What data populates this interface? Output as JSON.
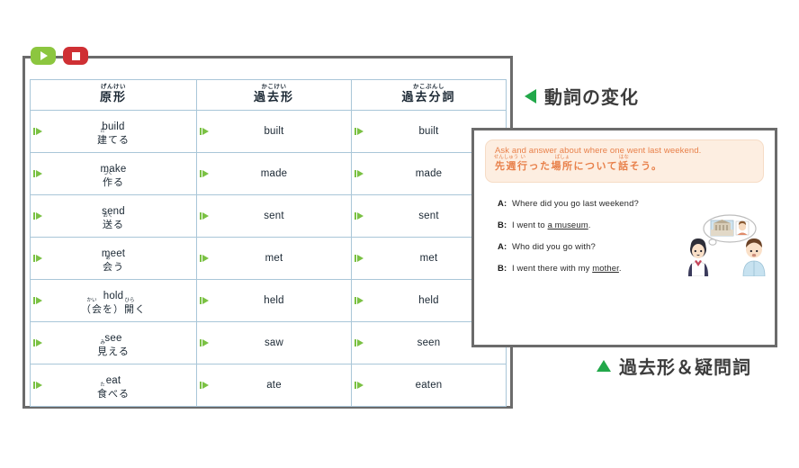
{
  "window": {
    "transport": [
      {
        "name": "play-button",
        "icon": "play-icon",
        "color": "#8cc63f"
      },
      {
        "name": "stop-button",
        "icon": "stop-icon",
        "color": "#cf3034"
      }
    ]
  },
  "table": {
    "headers": [
      {
        "furigana": "げんけい",
        "label": "原形"
      },
      {
        "furigana": "かこけい",
        "label": "過去形"
      },
      {
        "furigana": "かこぶんし",
        "label": "過去分詞"
      }
    ],
    "rows": [
      {
        "base_en": "build",
        "base_jp_ruby": "た",
        "base_jp_kanji": "建",
        "base_jp_tail": "てる",
        "past": "built",
        "participle": "built"
      },
      {
        "base_en": "make",
        "base_jp_ruby": "つく",
        "base_jp_kanji": "作",
        "base_jp_tail": "る",
        "past": "made",
        "participle": "made"
      },
      {
        "base_en": "send",
        "base_jp_ruby": "おく",
        "base_jp_kanji": "送",
        "base_jp_tail": "る",
        "past": "sent",
        "participle": "sent"
      },
      {
        "base_en": "meet",
        "base_jp_ruby": "あ",
        "base_jp_kanji": "会",
        "base_jp_tail": "う",
        "past": "met",
        "participle": "met"
      },
      {
        "base_en": "hold",
        "base_jp_ruby": "かい",
        "base_jp_kanji": "（会",
        "base_jp_tail": "を）",
        "base_jp_ruby2": "ひら",
        "base_jp_kanji2": "開",
        "base_jp_tail2": "く",
        "past": "held",
        "participle": "held"
      },
      {
        "base_en": "see",
        "base_jp_ruby": "み",
        "base_jp_kanji": "見",
        "base_jp_tail": "える",
        "past": "saw",
        "participle": "seen"
      },
      {
        "base_en": "eat",
        "base_jp_ruby": "た",
        "base_jp_kanji": "食",
        "base_jp_tail": "べる",
        "past": "ate",
        "participle": "eaten"
      }
    ]
  },
  "labels": {
    "verbs": "動詞の変化",
    "past": "過去形＆疑問詞"
  },
  "popup": {
    "task_en": "Ask and answer about where one went last weekend.",
    "task_jp": {
      "r1": "せんしゅう",
      "k1": "先週",
      "r2": "い",
      "k2": "行",
      "t2": "った",
      "r3": "ばしょ",
      "k3": "場所",
      "t3": "について",
      "r4": "はな",
      "k4": "話",
      "t4": "そう。"
    },
    "dialogue": [
      {
        "speaker": "A:",
        "pre": "Where did you go last weekend?",
        "underline": "",
        "post": ""
      },
      {
        "speaker": "B:",
        "pre": "I went to ",
        "underline": "a museum",
        "post": "."
      },
      {
        "speaker": "A:",
        "pre": "Who did you go with?",
        "underline": "",
        "post": ""
      },
      {
        "speaker": "B:",
        "pre": "I went there with my ",
        "underline": "mother",
        "post": "."
      }
    ],
    "illustration": {
      "name": "students-talking-illustration",
      "bubble_contents": [
        "museum-photo",
        "person-photo"
      ]
    }
  },
  "colors": {
    "accent_green": "#22a84a",
    "audio_green": "#7ac143",
    "table_border": "#a9c6d8",
    "frame_gray": "#6b6b6b",
    "task_orange": "#e8804a",
    "task_bg": "#fdeee1"
  }
}
